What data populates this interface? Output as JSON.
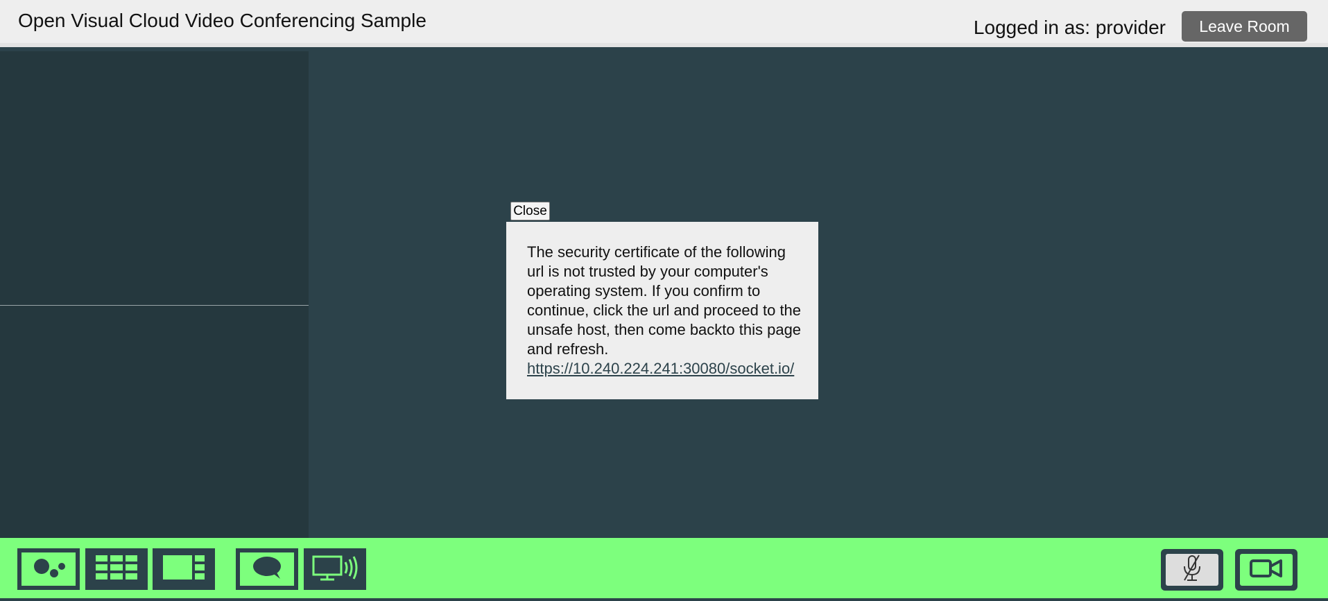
{
  "header": {
    "title": "Open Visual Cloud Video Conferencing Sample",
    "login_text": "Logged in as: provider",
    "leave_label": "Leave Room"
  },
  "dialog": {
    "close_label": "Close",
    "message": "The security certificate of the following url is not trusted by your computer's operating system. If you confirm to continue, click the url and proceed to the unsafe host, then come backto this page and refresh.",
    "link": "https://10.240.224.241:30080/socket.io/"
  },
  "toolbar": {
    "left_icons": [
      "speaker-layout-icon",
      "grid-layout-icon",
      "sidebar-layout-icon",
      "chat-icon",
      "screen-share-icon"
    ],
    "right_icons": [
      "mic-muted-icon",
      "video-camera-icon"
    ]
  },
  "colors": {
    "header_bg": "#eeeeee",
    "main_bg": "#2c424a",
    "left_panel_bg": "#25383e",
    "footer_bg": "#7dff7d",
    "leave_button_bg": "#666666",
    "dialog_bg": "#eeeeee"
  }
}
